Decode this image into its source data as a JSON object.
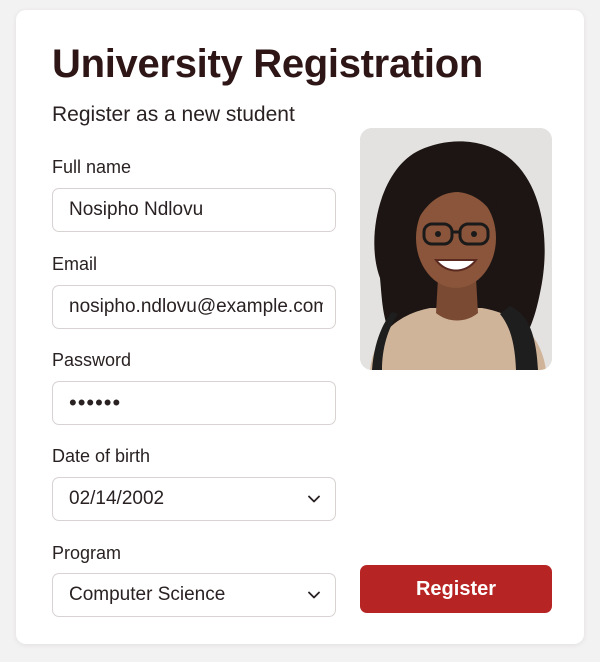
{
  "form": {
    "title": "University Registration",
    "subtitle": "Register as a new student",
    "fields": {
      "full_name": {
        "label": "Full name",
        "value": "Nosipho Ndlovu"
      },
      "email": {
        "label": "Email",
        "value": "nosipho.ndlovu@example.com"
      },
      "password": {
        "label": "Password",
        "value": "••••••"
      },
      "date_of_birth": {
        "label": "Date of birth",
        "value": "02/14/2002"
      },
      "program": {
        "label": "Program",
        "value": "Computer Science"
      }
    },
    "submit_label": "Register"
  },
  "colors": {
    "accent": "#b72424",
    "title": "#2e1616",
    "background": "#f3f2f2"
  },
  "icons": {
    "select_chevron": "chevron-down-icon"
  }
}
